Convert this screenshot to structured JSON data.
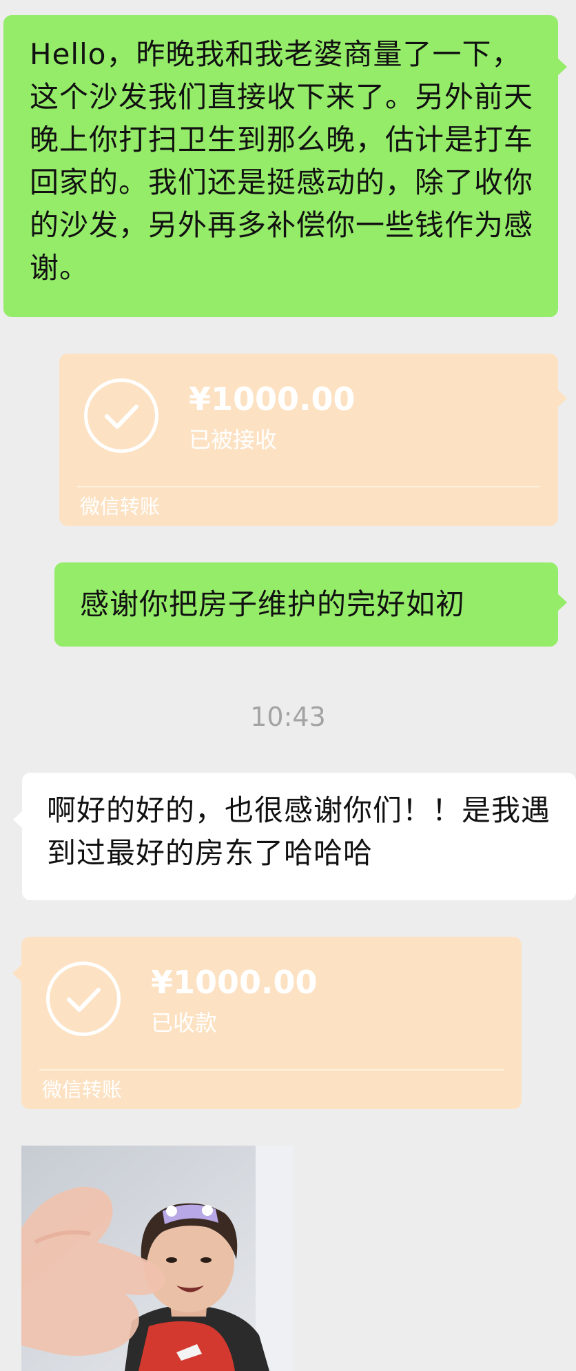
{
  "chat": {
    "messages": [
      {
        "sender": "me",
        "type": "text",
        "text": "Hello，昨晚我和我老婆商量了一下，这个沙发我们直接收下来了。另外前天晚上你打扫卫生到那么晚，估计是打车回家的。我们还是挺感动的，除了收你的沙发，另外再多补偿你一些钱作为感谢。"
      },
      {
        "sender": "me",
        "type": "transfer",
        "amount": "¥1000.00",
        "status": "已被接收",
        "brand": "微信转账"
      },
      {
        "sender": "me",
        "type": "text",
        "text": "感谢你把房子维护的完好如初"
      },
      {
        "type": "timestamp",
        "text": "10:43"
      },
      {
        "sender": "other",
        "type": "text",
        "text": "啊好的好的，也很感谢你们！！是我遇到过最好的房东了哈哈哈"
      },
      {
        "sender": "other",
        "type": "transfer",
        "amount": "¥1000.00",
        "status": "已收款",
        "brand": "微信转账"
      },
      {
        "sender": "other",
        "type": "sticker",
        "icon": "thumbs-up-sticker"
      }
    ]
  },
  "colors": {
    "background": "#ededed",
    "sent_bubble": "#95ec69",
    "received_bubble": "#ffffff",
    "transfer_card": "#fce2c3",
    "timestamp": "#a3a3a3"
  }
}
